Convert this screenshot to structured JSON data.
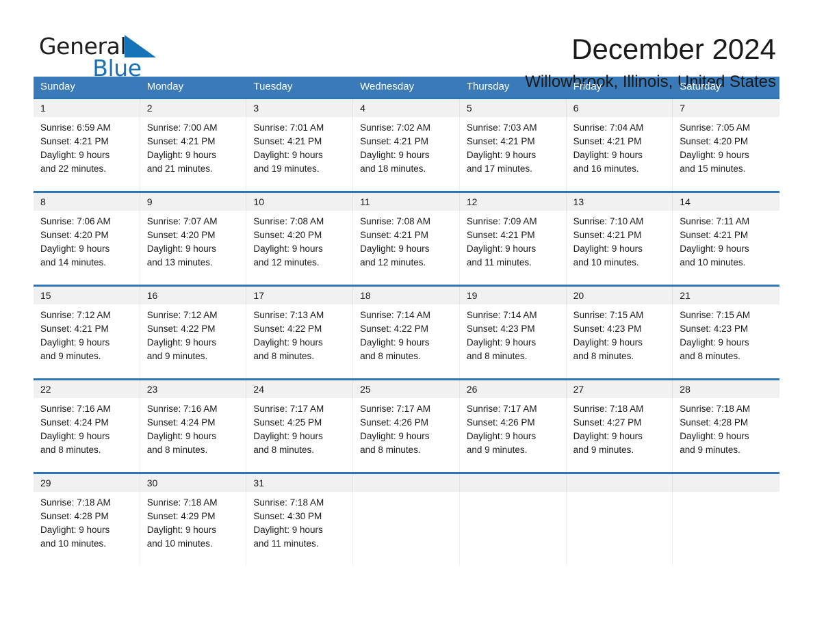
{
  "logo": {
    "text_dark": "General",
    "text_blue": "Blue",
    "triangle_color": "#1773b8"
  },
  "header": {
    "month_title": "December 2024",
    "location": "Willowbrook, Illinois, United States"
  },
  "theme": {
    "header_blue": "#3a7ab8",
    "row_divider_blue": "#2e75b6",
    "daynum_band": "#f1f1f1",
    "text": "#1a1a1a"
  },
  "calendar": {
    "weekdays": [
      "Sunday",
      "Monday",
      "Tuesday",
      "Wednesday",
      "Thursday",
      "Friday",
      "Saturday"
    ],
    "weeks": [
      [
        {
          "day": "1",
          "sunrise": "Sunrise: 6:59 AM",
          "sunset": "Sunset: 4:21 PM",
          "daylight1": "Daylight: 9 hours",
          "daylight2": "and 22 minutes."
        },
        {
          "day": "2",
          "sunrise": "Sunrise: 7:00 AM",
          "sunset": "Sunset: 4:21 PM",
          "daylight1": "Daylight: 9 hours",
          "daylight2": "and 21 minutes."
        },
        {
          "day": "3",
          "sunrise": "Sunrise: 7:01 AM",
          "sunset": "Sunset: 4:21 PM",
          "daylight1": "Daylight: 9 hours",
          "daylight2": "and 19 minutes."
        },
        {
          "day": "4",
          "sunrise": "Sunrise: 7:02 AM",
          "sunset": "Sunset: 4:21 PM",
          "daylight1": "Daylight: 9 hours",
          "daylight2": "and 18 minutes."
        },
        {
          "day": "5",
          "sunrise": "Sunrise: 7:03 AM",
          "sunset": "Sunset: 4:21 PM",
          "daylight1": "Daylight: 9 hours",
          "daylight2": "and 17 minutes."
        },
        {
          "day": "6",
          "sunrise": "Sunrise: 7:04 AM",
          "sunset": "Sunset: 4:21 PM",
          "daylight1": "Daylight: 9 hours",
          "daylight2": "and 16 minutes."
        },
        {
          "day": "7",
          "sunrise": "Sunrise: 7:05 AM",
          "sunset": "Sunset: 4:20 PM",
          "daylight1": "Daylight: 9 hours",
          "daylight2": "and 15 minutes."
        }
      ],
      [
        {
          "day": "8",
          "sunrise": "Sunrise: 7:06 AM",
          "sunset": "Sunset: 4:20 PM",
          "daylight1": "Daylight: 9 hours",
          "daylight2": "and 14 minutes."
        },
        {
          "day": "9",
          "sunrise": "Sunrise: 7:07 AM",
          "sunset": "Sunset: 4:20 PM",
          "daylight1": "Daylight: 9 hours",
          "daylight2": "and 13 minutes."
        },
        {
          "day": "10",
          "sunrise": "Sunrise: 7:08 AM",
          "sunset": "Sunset: 4:20 PM",
          "daylight1": "Daylight: 9 hours",
          "daylight2": "and 12 minutes."
        },
        {
          "day": "11",
          "sunrise": "Sunrise: 7:08 AM",
          "sunset": "Sunset: 4:21 PM",
          "daylight1": "Daylight: 9 hours",
          "daylight2": "and 12 minutes."
        },
        {
          "day": "12",
          "sunrise": "Sunrise: 7:09 AM",
          "sunset": "Sunset: 4:21 PM",
          "daylight1": "Daylight: 9 hours",
          "daylight2": "and 11 minutes."
        },
        {
          "day": "13",
          "sunrise": "Sunrise: 7:10 AM",
          "sunset": "Sunset: 4:21 PM",
          "daylight1": "Daylight: 9 hours",
          "daylight2": "and 10 minutes."
        },
        {
          "day": "14",
          "sunrise": "Sunrise: 7:11 AM",
          "sunset": "Sunset: 4:21 PM",
          "daylight1": "Daylight: 9 hours",
          "daylight2": "and 10 minutes."
        }
      ],
      [
        {
          "day": "15",
          "sunrise": "Sunrise: 7:12 AM",
          "sunset": "Sunset: 4:21 PM",
          "daylight1": "Daylight: 9 hours",
          "daylight2": "and 9 minutes."
        },
        {
          "day": "16",
          "sunrise": "Sunrise: 7:12 AM",
          "sunset": "Sunset: 4:22 PM",
          "daylight1": "Daylight: 9 hours",
          "daylight2": "and 9 minutes."
        },
        {
          "day": "17",
          "sunrise": "Sunrise: 7:13 AM",
          "sunset": "Sunset: 4:22 PM",
          "daylight1": "Daylight: 9 hours",
          "daylight2": "and 8 minutes."
        },
        {
          "day": "18",
          "sunrise": "Sunrise: 7:14 AM",
          "sunset": "Sunset: 4:22 PM",
          "daylight1": "Daylight: 9 hours",
          "daylight2": "and 8 minutes."
        },
        {
          "day": "19",
          "sunrise": "Sunrise: 7:14 AM",
          "sunset": "Sunset: 4:23 PM",
          "daylight1": "Daylight: 9 hours",
          "daylight2": "and 8 minutes."
        },
        {
          "day": "20",
          "sunrise": "Sunrise: 7:15 AM",
          "sunset": "Sunset: 4:23 PM",
          "daylight1": "Daylight: 9 hours",
          "daylight2": "and 8 minutes."
        },
        {
          "day": "21",
          "sunrise": "Sunrise: 7:15 AM",
          "sunset": "Sunset: 4:23 PM",
          "daylight1": "Daylight: 9 hours",
          "daylight2": "and 8 minutes."
        }
      ],
      [
        {
          "day": "22",
          "sunrise": "Sunrise: 7:16 AM",
          "sunset": "Sunset: 4:24 PM",
          "daylight1": "Daylight: 9 hours",
          "daylight2": "and 8 minutes."
        },
        {
          "day": "23",
          "sunrise": "Sunrise: 7:16 AM",
          "sunset": "Sunset: 4:24 PM",
          "daylight1": "Daylight: 9 hours",
          "daylight2": "and 8 minutes."
        },
        {
          "day": "24",
          "sunrise": "Sunrise: 7:17 AM",
          "sunset": "Sunset: 4:25 PM",
          "daylight1": "Daylight: 9 hours",
          "daylight2": "and 8 minutes."
        },
        {
          "day": "25",
          "sunrise": "Sunrise: 7:17 AM",
          "sunset": "Sunset: 4:26 PM",
          "daylight1": "Daylight: 9 hours",
          "daylight2": "and 8 minutes."
        },
        {
          "day": "26",
          "sunrise": "Sunrise: 7:17 AM",
          "sunset": "Sunset: 4:26 PM",
          "daylight1": "Daylight: 9 hours",
          "daylight2": "and 9 minutes."
        },
        {
          "day": "27",
          "sunrise": "Sunrise: 7:18 AM",
          "sunset": "Sunset: 4:27 PM",
          "daylight1": "Daylight: 9 hours",
          "daylight2": "and 9 minutes."
        },
        {
          "day": "28",
          "sunrise": "Sunrise: 7:18 AM",
          "sunset": "Sunset: 4:28 PM",
          "daylight1": "Daylight: 9 hours",
          "daylight2": "and 9 minutes."
        }
      ],
      [
        {
          "day": "29",
          "sunrise": "Sunrise: 7:18 AM",
          "sunset": "Sunset: 4:28 PM",
          "daylight1": "Daylight: 9 hours",
          "daylight2": "and 10 minutes."
        },
        {
          "day": "30",
          "sunrise": "Sunrise: 7:18 AM",
          "sunset": "Sunset: 4:29 PM",
          "daylight1": "Daylight: 9 hours",
          "daylight2": "and 10 minutes."
        },
        {
          "day": "31",
          "sunrise": "Sunrise: 7:18 AM",
          "sunset": "Sunset: 4:30 PM",
          "daylight1": "Daylight: 9 hours",
          "daylight2": "and 11 minutes."
        },
        {
          "day": "",
          "sunrise": "",
          "sunset": "",
          "daylight1": "",
          "daylight2": ""
        },
        {
          "day": "",
          "sunrise": "",
          "sunset": "",
          "daylight1": "",
          "daylight2": ""
        },
        {
          "day": "",
          "sunrise": "",
          "sunset": "",
          "daylight1": "",
          "daylight2": ""
        },
        {
          "day": "",
          "sunrise": "",
          "sunset": "",
          "daylight1": "",
          "daylight2": ""
        }
      ]
    ]
  }
}
